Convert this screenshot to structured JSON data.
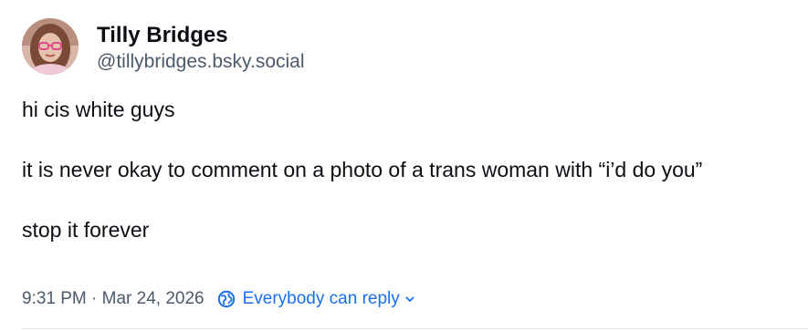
{
  "post": {
    "author": {
      "display_name": "Tilly Bridges",
      "handle": "@tillybridges.bsky.social",
      "avatar_icon": "avatar-photo"
    },
    "paragraphs": [
      "hi cis white guys",
      "it is never okay to comment on a photo of a trans woman with “i’d do you”",
      "stop it forever"
    ],
    "timestamp": "9:31 PM · Mar 24, 2026",
    "reply_setting": {
      "label": "Everybody can reply",
      "icon": "globe-icon",
      "chevron_icon": "chevron-down-icon"
    }
  },
  "colors": {
    "text": "#0b0f14",
    "muted": "#4b5a6b",
    "accent": "#1a6ff0",
    "divider": "#dfe4ea"
  }
}
